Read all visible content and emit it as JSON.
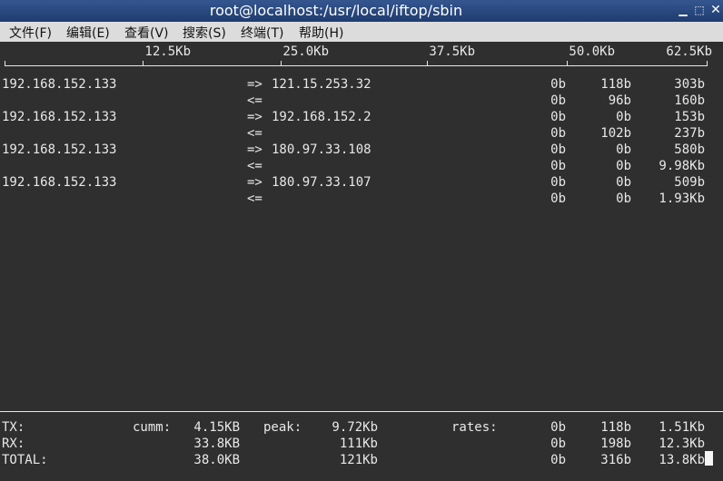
{
  "window": {
    "title": "root@localhost:/usr/local/iftop/sbin"
  },
  "menu": [
    "文件(F)",
    "编辑(E)",
    "查看(V)",
    "搜索(S)",
    "终端(T)",
    "帮助(H)"
  ],
  "scale": [
    "12.5Kb",
    "25.0Kb",
    "37.5Kb",
    "50.0Kb",
    "62.5Kb"
  ],
  "flows": [
    {
      "src": "192.168.152.133",
      "dst": "121.15.253.32",
      "tx": [
        "0b",
        "118b",
        "303b"
      ],
      "rx": [
        "0b",
        "96b",
        "160b"
      ]
    },
    {
      "src": "192.168.152.133",
      "dst": "192.168.152.2",
      "tx": [
        "0b",
        "0b",
        "153b"
      ],
      "rx": [
        "0b",
        "102b",
        "237b"
      ]
    },
    {
      "src": "192.168.152.133",
      "dst": "180.97.33.108",
      "tx": [
        "0b",
        "0b",
        "580b"
      ],
      "rx": [
        "0b",
        "0b",
        "9.98Kb"
      ]
    },
    {
      "src": "192.168.152.133",
      "dst": "180.97.33.107",
      "tx": [
        "0b",
        "0b",
        "509b"
      ],
      "rx": [
        "0b",
        "0b",
        "1.93Kb"
      ]
    }
  ],
  "arrows": {
    "out": "=>",
    "in": "<="
  },
  "summary": {
    "labels": {
      "cumm": "cumm:",
      "peak": "peak:",
      "rates": "rates:"
    },
    "rows": [
      {
        "label": "TX:",
        "cumm": "4.15KB",
        "peak": "9.72Kb",
        "rates": [
          "0b",
          "118b",
          "1.51Kb"
        ]
      },
      {
        "label": "RX:",
        "cumm": "33.8KB",
        "peak": "111Kb",
        "rates": [
          "0b",
          "198b",
          "12.3Kb"
        ]
      },
      {
        "label": "TOTAL:",
        "cumm": "38.0KB",
        "peak": "121Kb",
        "rates": [
          "0b",
          "316b",
          "13.8Kb"
        ]
      }
    ]
  }
}
